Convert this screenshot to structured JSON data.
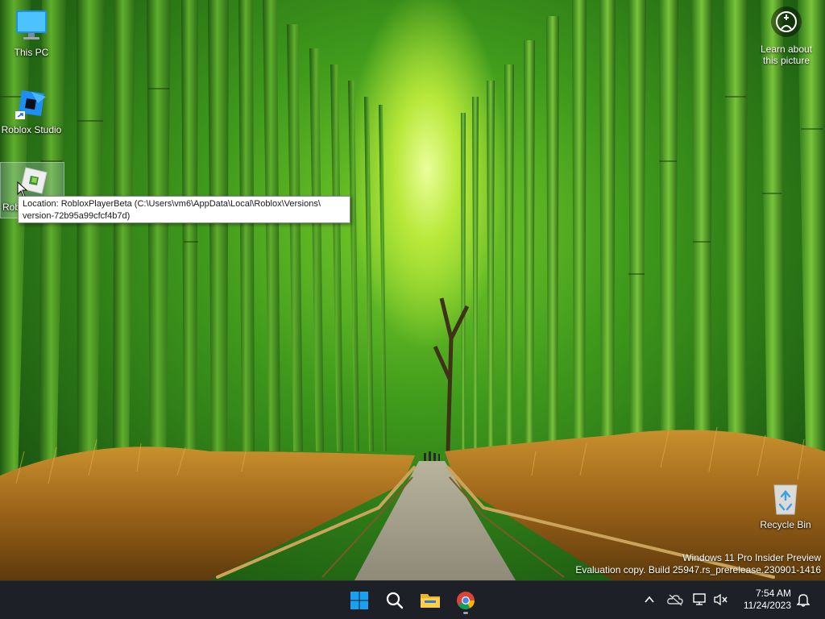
{
  "desktop": {
    "icons": [
      {
        "label": "This PC",
        "icon": "monitor-icon"
      },
      {
        "label": "Roblox Studio",
        "icon": "roblox-studio-icon"
      },
      {
        "label": "Rob",
        "icon": "roblox-player-icon"
      },
      {
        "label": "Recycle Bin",
        "icon": "recycle-bin-icon"
      }
    ],
    "tooltip": {
      "line1": "Location: RobloxPlayerBeta (C:\\Users\\vm6\\AppData\\Local\\Roblox\\Versions\\",
      "line2": "version-72b95a99cfcf4b7d)"
    },
    "learn_about": {
      "line1": "Learn about",
      "line2": "this picture",
      "icon": "camera-circle-icon"
    },
    "watermark": {
      "line1": "Windows 11 Pro Insider Preview",
      "line2": "Evaluation copy. Build 25947.rs_prerelease.230901-1416"
    }
  },
  "taskbar": {
    "pinned": [
      {
        "name": "Start",
        "icon": "windows-logo-icon"
      },
      {
        "name": "Search",
        "icon": "search-icon"
      },
      {
        "name": "File Explorer",
        "icon": "folder-icon"
      },
      {
        "name": "Google Chrome",
        "icon": "chrome-icon",
        "running": true
      }
    ],
    "tray": [
      "chevron-up-icon",
      "onedrive-offline-icon",
      "network-icon",
      "volume-muted-icon",
      "notification-bell-icon"
    ],
    "clock": {
      "time": "7:54 AM",
      "date": "11/24/2023"
    }
  },
  "colors": {
    "taskbar_bg": "#1d2027",
    "accent": "#0078d4"
  }
}
